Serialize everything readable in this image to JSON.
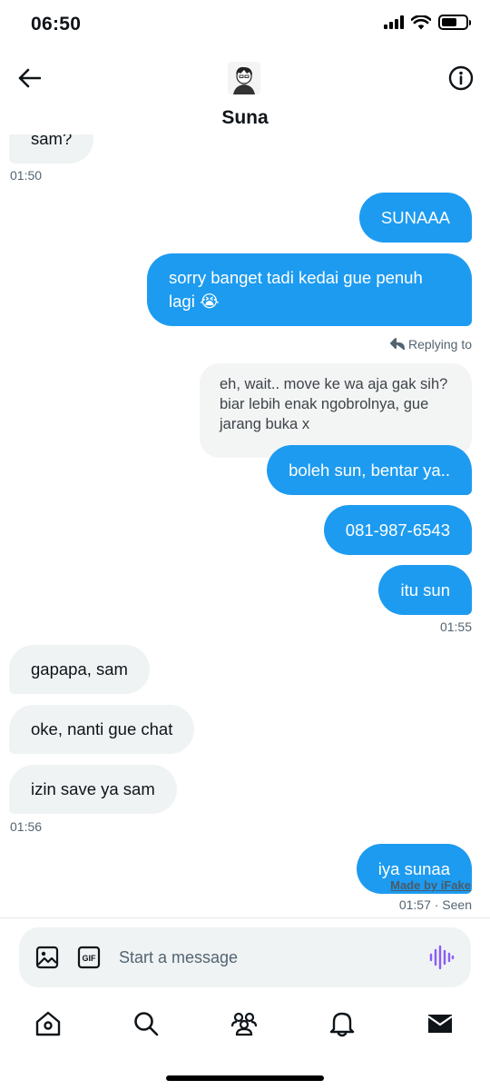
{
  "status_bar": {
    "time": "06:50",
    "battery_level": 0.65
  },
  "header": {
    "contact_name": "Suna"
  },
  "messages": [
    {
      "side": "in",
      "text": "sam?"
    },
    {
      "side": "out",
      "text": "SUNAAA"
    },
    {
      "side": "out",
      "text": "sorry banget tadi kedai gue penuh lagi 😭"
    },
    {
      "side": "out",
      "text": "boleh sun, bentar ya..",
      "quote": "eh, wait.. move ke wa aja gak sih? biar lebih enak ngobrolnya, gue jarang buka x",
      "replying_label": "Replying to"
    },
    {
      "side": "out",
      "text": "081-987-6543"
    },
    {
      "side": "out",
      "text": "itu sun"
    },
    {
      "side": "in",
      "text": "gapapa, sam"
    },
    {
      "side": "in",
      "text": "oke, nanti gue chat"
    },
    {
      "side": "in",
      "text": "izin save ya sam"
    },
    {
      "side": "out",
      "text": "iya sunaa"
    }
  ],
  "timestamps": {
    "t1": "01:50",
    "t2": "01:55",
    "t3": "01:56",
    "t4": "01:57 · Seen"
  },
  "watermark": "Made by iFake",
  "composer": {
    "placeholder": "Start a message",
    "value": ""
  },
  "nav": [
    "home",
    "search",
    "communities",
    "notifications",
    "messages"
  ],
  "colors": {
    "outgoing_bubble": "#1d9bf0",
    "incoming_bubble": "#eff3f4",
    "voice_icon": "#8b5cf6"
  }
}
